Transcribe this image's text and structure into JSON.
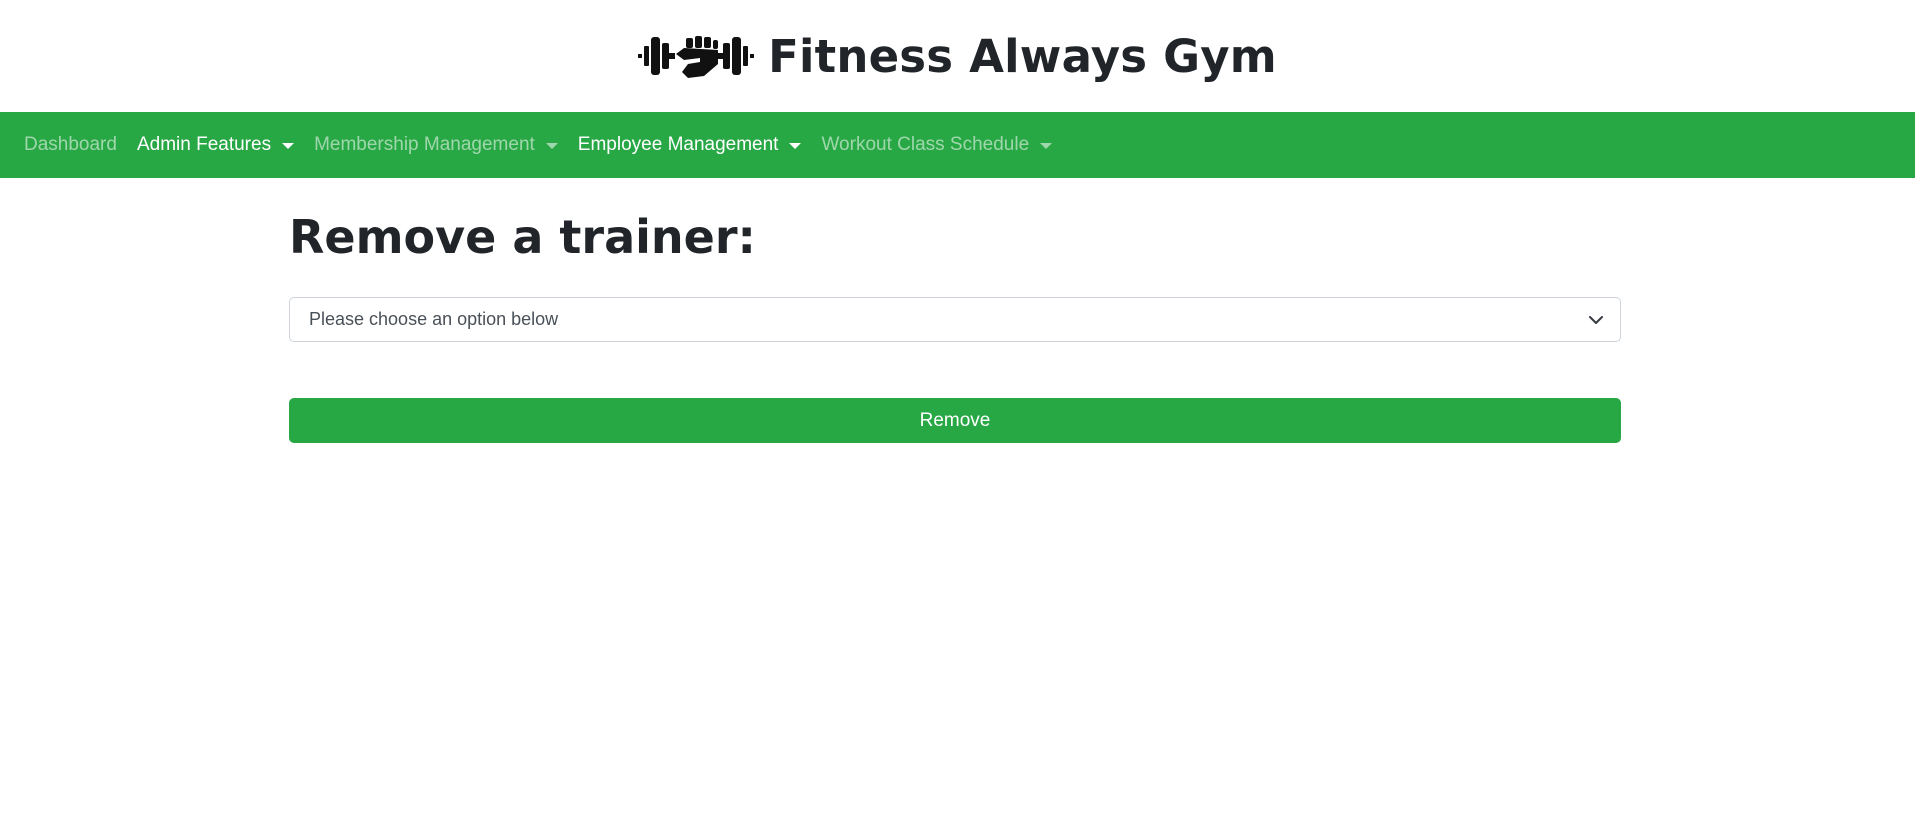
{
  "header": {
    "title": "Fitness Always Gym",
    "logo_icon": "dumbbell-fist-icon"
  },
  "nav": {
    "items": [
      {
        "label": "Dashboard",
        "dropdown": false,
        "active": false
      },
      {
        "label": "Admin Features",
        "dropdown": true,
        "active": true
      },
      {
        "label": "Membership Management",
        "dropdown": true,
        "active": false
      },
      {
        "label": "Employee Management",
        "dropdown": true,
        "active": true
      },
      {
        "label": "Workout Class Schedule",
        "dropdown": true,
        "active": false
      }
    ]
  },
  "main": {
    "title": "Remove a trainer:",
    "trainer_select": {
      "selected": "Please choose an option below"
    },
    "remove_label": "Remove"
  },
  "colors": {
    "brand_green": "#28a745",
    "text_dark": "#212529"
  }
}
